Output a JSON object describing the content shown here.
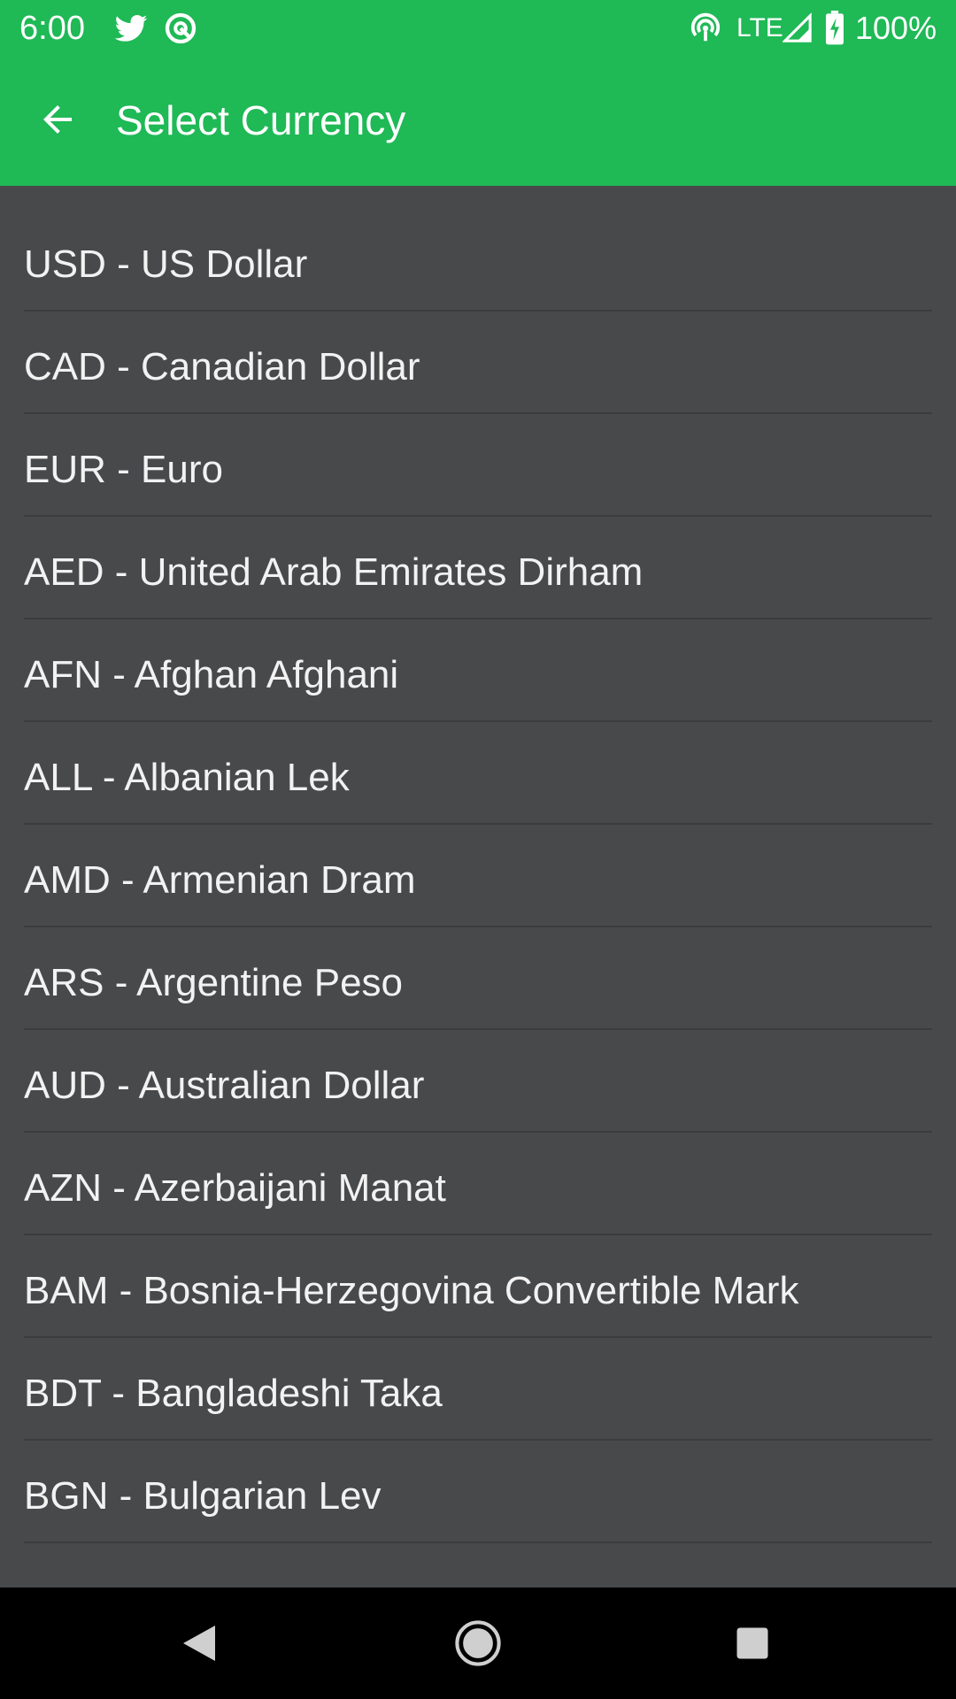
{
  "status_bar": {
    "time": "6:00",
    "network": "LTE",
    "battery": "100%",
    "icons": [
      "twitter-icon",
      "app-notification-icon",
      "hotspot-icon",
      "signal-icon",
      "battery-charging-icon"
    ]
  },
  "toolbar": {
    "title": "Select Currency",
    "back_icon": "arrow-back-icon"
  },
  "currencies": [
    {
      "label": "USD - US Dollar"
    },
    {
      "label": "CAD - Canadian Dollar"
    },
    {
      "label": "EUR - Euro"
    },
    {
      "label": "AED - United Arab Emirates Dirham"
    },
    {
      "label": "AFN - Afghan Afghani"
    },
    {
      "label": "ALL - Albanian Lek"
    },
    {
      "label": "AMD - Armenian Dram"
    },
    {
      "label": "ARS - Argentine Peso"
    },
    {
      "label": "AUD - Australian Dollar"
    },
    {
      "label": "AZN - Azerbaijani Manat"
    },
    {
      "label": "BAM - Bosnia-Herzegovina Convertible Mark"
    },
    {
      "label": "BDT - Bangladeshi Taka"
    },
    {
      "label": "BGN - Bulgarian Lev"
    }
  ],
  "nav_bar": {
    "icons": [
      "back-triangle-icon",
      "home-circle-icon",
      "recents-square-icon"
    ]
  },
  "colors": {
    "accent": "#1fb956",
    "list_background": "#48494b",
    "divider": "#3b3c3e",
    "text": "#f2f2f2"
  }
}
